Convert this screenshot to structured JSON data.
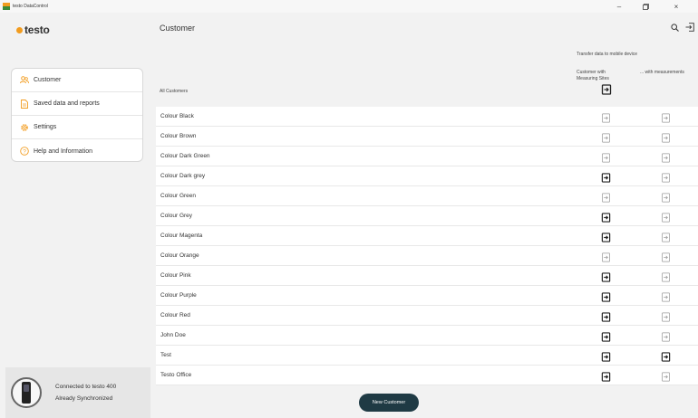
{
  "window": {
    "title": "testo DataControl",
    "minimize_glyph": "–",
    "restore_glyph": "▫",
    "close_glyph": "×"
  },
  "logo": {
    "text": "testo",
    "dot_color": "#f29c1f"
  },
  "sidebar": {
    "items": [
      {
        "label": "Customer",
        "icon": "customers-icon"
      },
      {
        "label": "Saved data and reports",
        "icon": "document-icon"
      },
      {
        "label": "Settings",
        "icon": "gear-icon"
      },
      {
        "label": "Help and Information",
        "icon": "help-icon"
      }
    ],
    "accent_color": "#f29c1f"
  },
  "device": {
    "line1": "Connected to testo 400",
    "line2": "Already Synchronized"
  },
  "main": {
    "title": "Customer",
    "transfer_label": "Transfer data to mobile device",
    "col1_label_line1": "Customer with",
    "col1_label_line2": "Measuring Sites",
    "col2_label": "... with measurements",
    "all_customers_label": "All Customers",
    "new_customer_button": "New Customer",
    "button_color": "#1f3a44"
  },
  "customers": [
    {
      "name": "Colour Black",
      "sites": false,
      "measurements": false
    },
    {
      "name": "Colour Brown",
      "sites": false,
      "measurements": false
    },
    {
      "name": "Colour Dark Green",
      "sites": false,
      "measurements": false
    },
    {
      "name": "Colour Dark grey",
      "sites": true,
      "measurements": false
    },
    {
      "name": "Colour Green",
      "sites": false,
      "measurements": false
    },
    {
      "name": "Colour Grey",
      "sites": true,
      "measurements": false
    },
    {
      "name": "Colour Magenta",
      "sites": true,
      "measurements": false
    },
    {
      "name": "Colour Orange",
      "sites": false,
      "measurements": false
    },
    {
      "name": "Colour Pink",
      "sites": true,
      "measurements": false
    },
    {
      "name": "Colour Purple",
      "sites": true,
      "measurements": false
    },
    {
      "name": "Colour Red",
      "sites": true,
      "measurements": false
    },
    {
      "name": "John Doe",
      "sites": true,
      "measurements": false
    },
    {
      "name": "Test",
      "sites": true,
      "measurements": true
    },
    {
      "name": "Testo Office",
      "sites": true,
      "measurements": false
    }
  ]
}
